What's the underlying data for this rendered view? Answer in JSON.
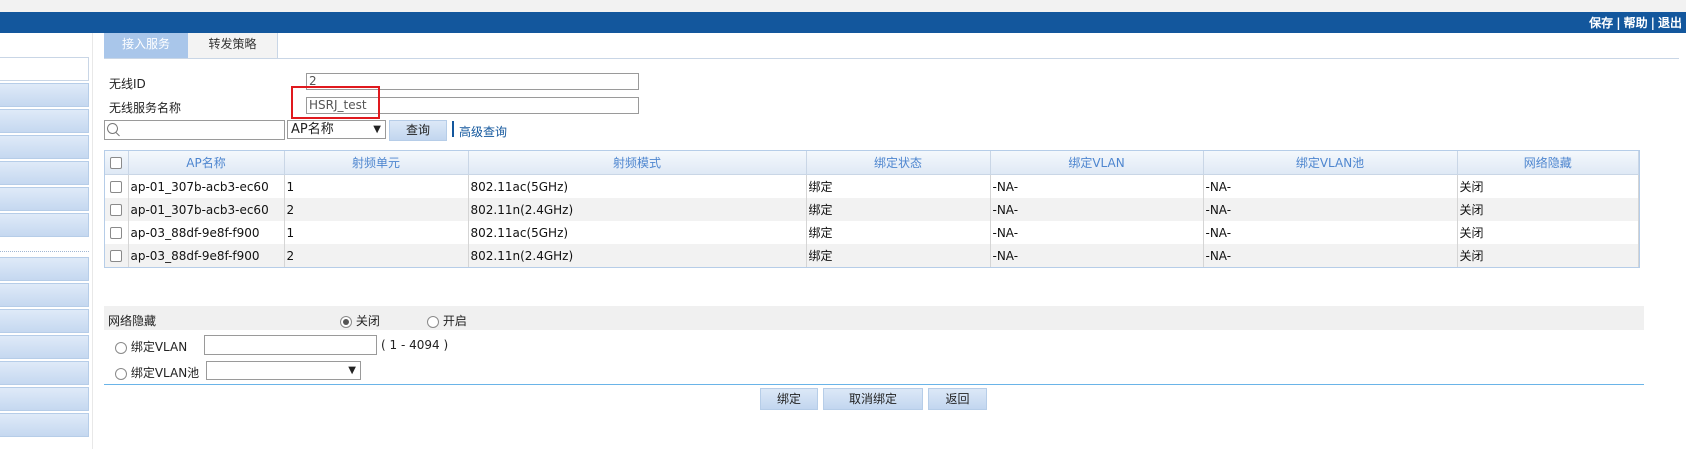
{
  "header": {
    "links": [
      "保存",
      "帮助",
      "退出"
    ],
    "separator": "|",
    "color": "#13579d"
  },
  "tabs": [
    {
      "label": "接入服务",
      "active": true
    },
    {
      "label": "转发策略",
      "active": false
    }
  ],
  "form": {
    "wireless_id_label": "无线ID",
    "wireless_id_value": "2",
    "service_name_label": "无线服务名称",
    "service_name_value": "HSRJ_test"
  },
  "search": {
    "icon": "search-icon",
    "field_select": "AP名称",
    "query_button": "查询",
    "advanced_link": "高级查询"
  },
  "table": {
    "columns": [
      "AP名称",
      "射频单元",
      "射频模式",
      "绑定状态",
      "绑定VLAN",
      "绑定VLAN池",
      "网络隐藏"
    ],
    "rows": [
      [
        "ap-01_307b-acb3-ec60",
        "1",
        "802.11ac(5GHz)",
        "绑定",
        "-NA-",
        "-NA-",
        "关闭"
      ],
      [
        "ap-01_307b-acb3-ec60",
        "2",
        "802.11n(2.4GHz)",
        "绑定",
        "-NA-",
        "-NA-",
        "关闭"
      ],
      [
        "ap-03_88df-9e8f-f900",
        "1",
        "802.11ac(5GHz)",
        "绑定",
        "-NA-",
        "-NA-",
        "关闭"
      ],
      [
        "ap-03_88df-9e8f-f900",
        "2",
        "802.11n(2.4GHz)",
        "绑定",
        "-NA-",
        "-NA-",
        "关闭"
      ]
    ]
  },
  "settings": {
    "network_hide_label": "网络隐藏",
    "option_off": "关闭",
    "option_on": "开启",
    "selected": "关闭",
    "bind_vlan_label": "绑定VLAN",
    "vlan_value": "",
    "vlan_range": "( 1 - 4094 )",
    "bind_vlan_pool_label": "绑定VLAN池",
    "vlan_pool_value": ""
  },
  "actions": {
    "bind": "绑定",
    "unbind": "取消绑定",
    "back": "返回"
  }
}
